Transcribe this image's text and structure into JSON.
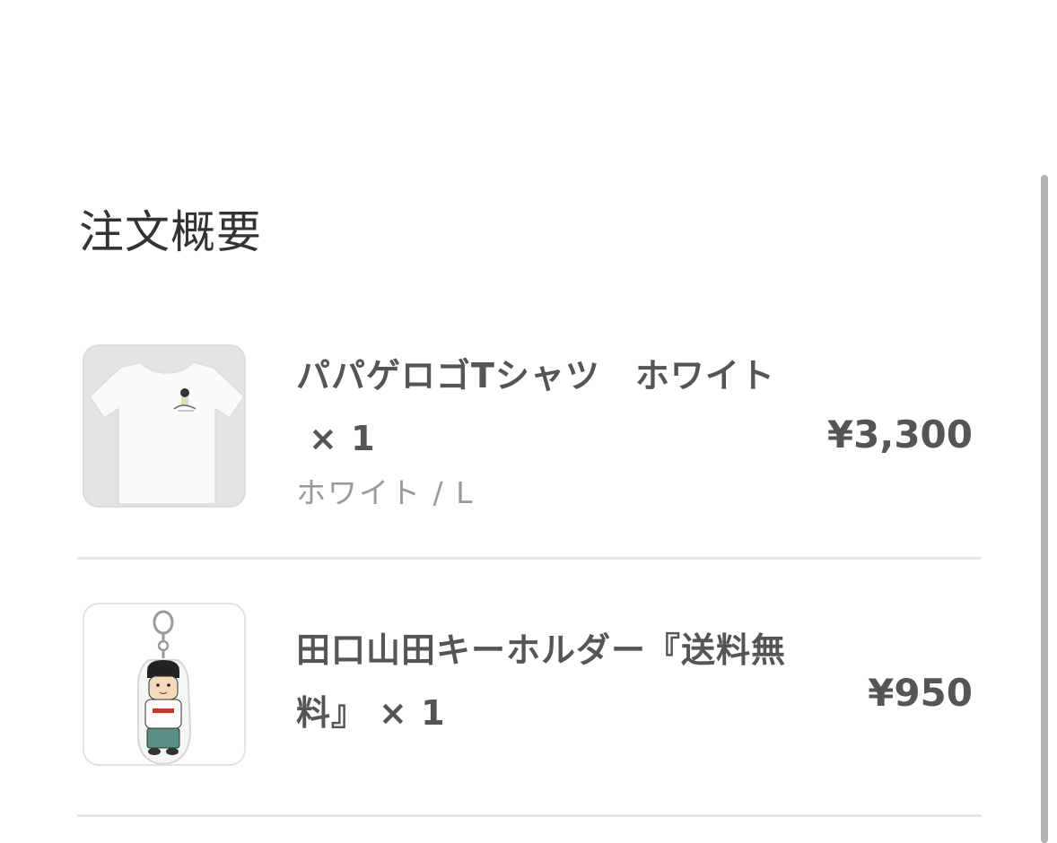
{
  "page": {
    "title": "注文概要"
  },
  "order_items": [
    {
      "name": "パパゲロゴTシャツ　ホワイト",
      "quantity": "× 1",
      "variant": "ホワイト / L",
      "price": "¥3,300",
      "thumbnail_icon": "white-tshirt-image"
    },
    {
      "name": "田口山田キーホルダー『送料無料』",
      "quantity": "× 1",
      "price": "¥950",
      "thumbnail_icon": "acrylic-keyholder-image"
    }
  ],
  "colors": {
    "background": "#ffffff",
    "text_primary": "#555555",
    "text_muted": "#9a9a9a",
    "divider": "#e6e6e6",
    "thumbnail_bg": "#e4e4e4"
  }
}
